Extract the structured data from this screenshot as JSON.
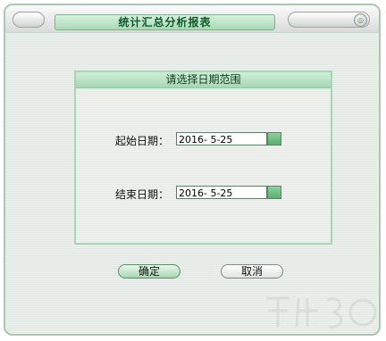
{
  "window": {
    "title": "统计汇总分析报表"
  },
  "panel": {
    "title": "请选择日期范围"
  },
  "start": {
    "label": "起始日期：",
    "value": "2016- 5-25"
  },
  "end": {
    "label": "结束日期：",
    "value": "2016- 5-25"
  },
  "buttons": {
    "ok": "确定",
    "cancel": "取消"
  },
  "colors": {
    "accent": "#a7d6b3",
    "header_text": "#0f5a2c"
  },
  "icons": {
    "close": "close-icon",
    "dropdown": "calendar-dropdown-icon"
  }
}
